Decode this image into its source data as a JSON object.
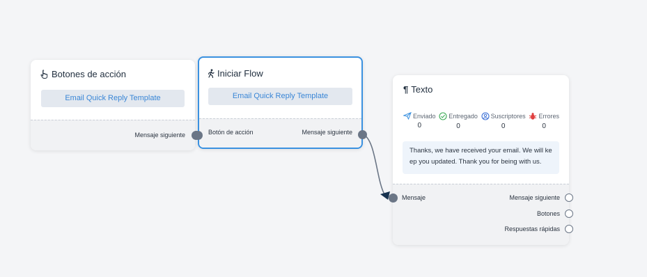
{
  "nodes": {
    "botones": {
      "title": "Botones de acción",
      "icon": "pointing-hand-icon",
      "button_label": "Email Quick Reply Template",
      "output_label": "Mensaje siguiente"
    },
    "iniciar_flow": {
      "title": "Iniciar Flow",
      "icon": "running-person-icon",
      "button_label": "Email Quick Reply Template",
      "input_label": "Botón de acción",
      "output_label": "Mensaje siguiente"
    },
    "texto": {
      "title": "Texto",
      "icon": "pilcrow-icon",
      "stats": [
        {
          "label": "Enviado",
          "value": "0",
          "icon": "send-icon",
          "color": "#3a91e0"
        },
        {
          "label": "Entregado",
          "value": "0",
          "icon": "check-circle-icon",
          "color": "#3aaa55"
        },
        {
          "label": "Suscriptores",
          "value": "0",
          "icon": "user-circle-icon",
          "color": "#3a6fd6"
        },
        {
          "label": "Errores",
          "value": "0",
          "icon": "bug-icon",
          "color": "#e04040"
        }
      ],
      "message": "Thanks, we have received your email. We will keep you updated. Thank you for being with us.",
      "input_label": "Mensaje",
      "outputs": [
        "Mensaje siguiente",
        "Botones",
        "Respuestas rápidas"
      ]
    }
  },
  "colors": {
    "accent": "#3a91e0",
    "chip_text": "#3a86d6",
    "port": "#6b7686",
    "canvas": "#f4f5f7"
  }
}
